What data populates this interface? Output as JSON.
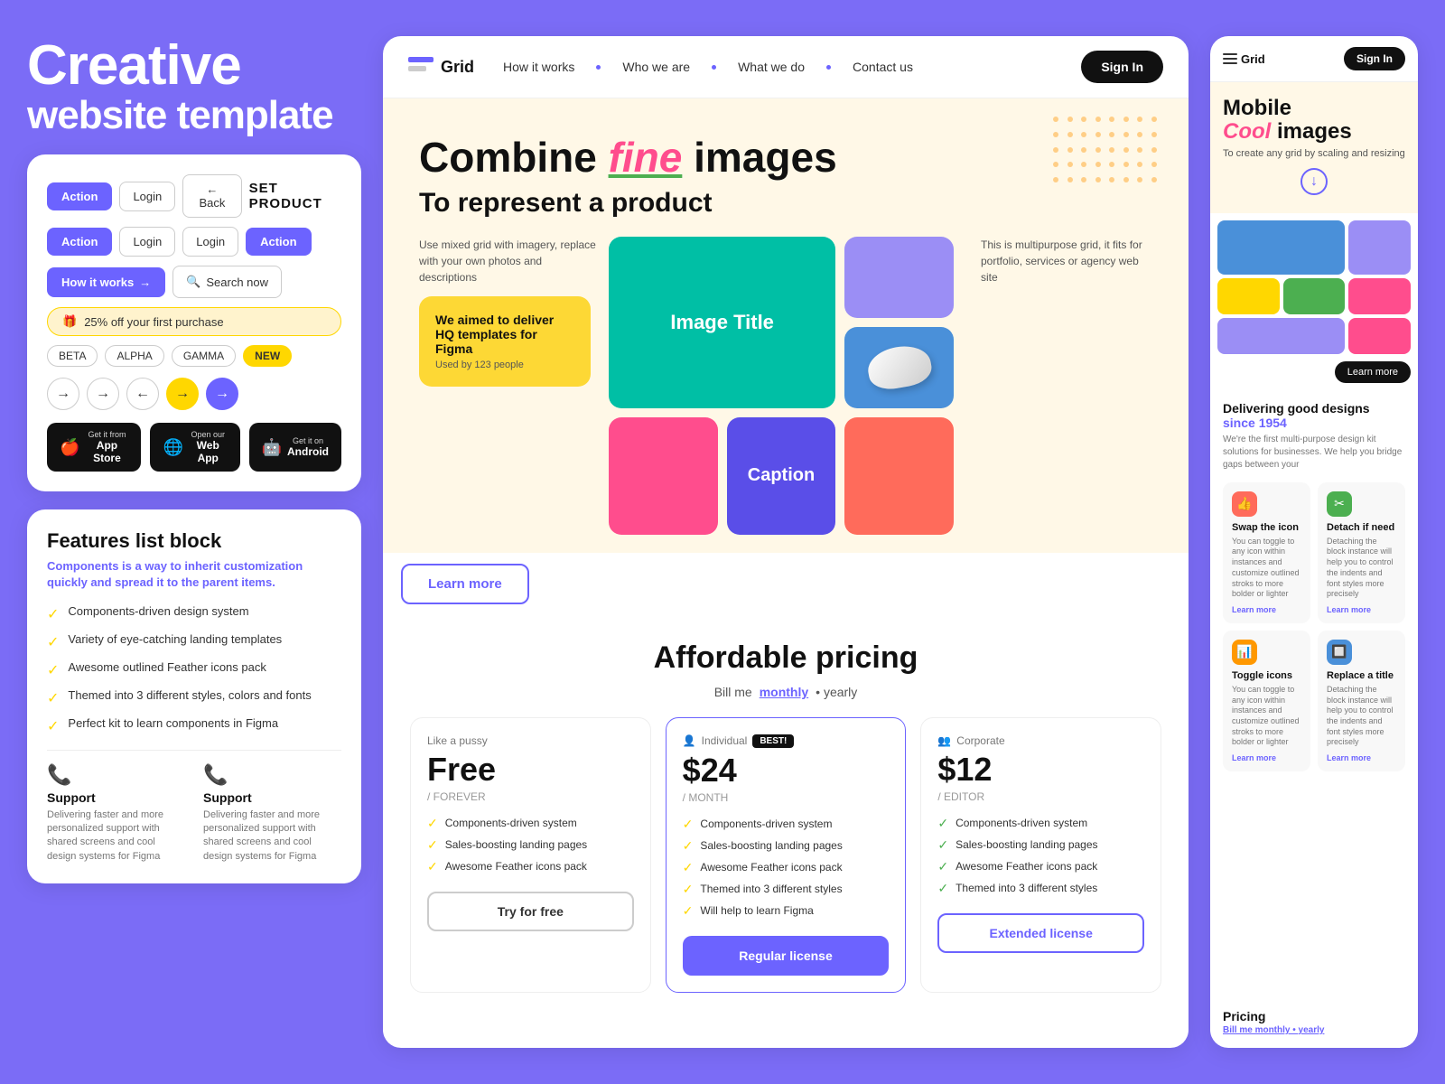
{
  "page": {
    "background_color": "#7B6CF6"
  },
  "left_title": {
    "line1": "Creative",
    "line2": "website template"
  },
  "ui_card": {
    "btn_action_1": "Action",
    "btn_login_1": "Login",
    "btn_back": "← Back",
    "btn_brand": "SET PRODUCT",
    "btn_action_2": "Action",
    "btn_login_2": "Login",
    "btn_login_3": "Login",
    "btn_action_3": "Action",
    "how_it_works": "How it works",
    "search_now": "Search now",
    "discount_text": "25% off your first purchase",
    "tags": [
      "BETA",
      "ALPHA",
      "GAMMA",
      "NEW"
    ],
    "store_app": "App Store",
    "store_web": "Open our Web App",
    "store_android": "Get it on Android",
    "store_get1": "Get it from",
    "store_open": "Open our",
    "store_get2": "Get it on"
  },
  "features_card": {
    "title": "Features list block",
    "subtitle": "Components is a way to inherit customization quickly and spread it to the parent items.",
    "items": [
      "Components-driven design system",
      "Variety of eye-catching landing templates",
      "Awesome outlined Feather icons pack",
      "Themed into 3 different styles, colors and fonts",
      "Perfect kit to learn components in Figma"
    ],
    "support1_label": "Support",
    "support1_desc": "Delivering faster and more personalized support with shared screens and cool design systems for Figma",
    "support2_label": "Support",
    "support2_desc": "Delivering faster and more personalized support with shared screens and cool design systems for Figma"
  },
  "navbar": {
    "logo": "Grid",
    "links": [
      "How it works",
      "Who we are",
      "What we do",
      "Contact us"
    ],
    "sign_in": "Sign In"
  },
  "hero": {
    "headline_pre": "Combine ",
    "headline_highlight": "fine",
    "headline_post": " images",
    "sub": "To represent a product",
    "body_text": "Use mixed grid with imagery, replace with your own photos and descriptions",
    "yellow_card_title": "We aimed to deliver HQ templates for Figma",
    "yellow_card_sub": "Used by 123 people",
    "right_text": "This is multipurpose grid, it fits for portfolio, services or agency web site",
    "image_title": "Image Title",
    "caption": "Caption",
    "learn_more": "Learn more"
  },
  "pricing": {
    "title": "Affordable pricing",
    "billing_pre": "Bill me ",
    "billing_monthly": "monthly",
    "billing_post": " • yearly",
    "plans": [
      {
        "label": "Like a pussy",
        "name": "Free",
        "period": "/ FOREVER",
        "features": [
          "Components-driven system",
          "Sales-boosting landing pages",
          "Awesome Feather icons pack"
        ],
        "btn_label": "Try for free",
        "btn_type": "outline"
      },
      {
        "label": "Individual",
        "badge": "BEST!",
        "name": "$24",
        "period": "/ MONTH",
        "features": [
          "Components-driven system",
          "Sales-boosting landing pages",
          "Awesome Feather icons pack",
          "Themed into 3 different styles",
          "Will help to learn Figma"
        ],
        "btn_label": "Regular license",
        "btn_type": "featured"
      },
      {
        "label": "Corporate",
        "name": "$12",
        "period": "/ EDITOR",
        "features": [
          "Components-driven system",
          "Sales-boosting landing pages",
          "Awesome Feather icons pack",
          "Themed into 3 different styles"
        ],
        "btn_label": "Extended license",
        "btn_type": "outlined"
      }
    ]
  },
  "mobile_panel": {
    "logo": "Grid",
    "sign_in": "Sign In",
    "hero_title_pre": "Mobile",
    "hero_title_highlight": "Cool",
    "hero_title_post": "images",
    "hero_sub": "To create any grid by scaling and resizing",
    "since_label": "Delivering good designs",
    "since_year": "since 1954",
    "since_desc": "We're the first multi-purpose design kit solutions for businesses. We help you bridge gaps between    your",
    "features": [
      {
        "icon": "👍",
        "icon_bg": "red",
        "title": "Swap the icon",
        "desc": "You can toggle to any icon within instances and customize outlined stroks to more bolder or lighter",
        "learn": "Learn more"
      },
      {
        "icon": "✂",
        "icon_bg": "green",
        "title": "Detach if need",
        "desc": "Detaching the block instance will help you to control the indents and font styles more precisely",
        "learn": "Learn more"
      },
      {
        "icon": "📊",
        "icon_bg": "orange",
        "title": "Toggle icons",
        "desc": "You can toggle to any icon within instances and customize outlined stroks to more bolder or lighter",
        "learn": "Learn more"
      },
      {
        "icon": "🔲",
        "icon_bg": "blue",
        "title": "Replace a title",
        "desc": "Detaching the block instance will help you to control the indents and font styles more precisely",
        "learn": "Learn more"
      }
    ],
    "pricing_title": "Pricing",
    "pricing_toggle_pre": "Bill me monthly • ",
    "pricing_toggle_highlight": "yearly"
  }
}
